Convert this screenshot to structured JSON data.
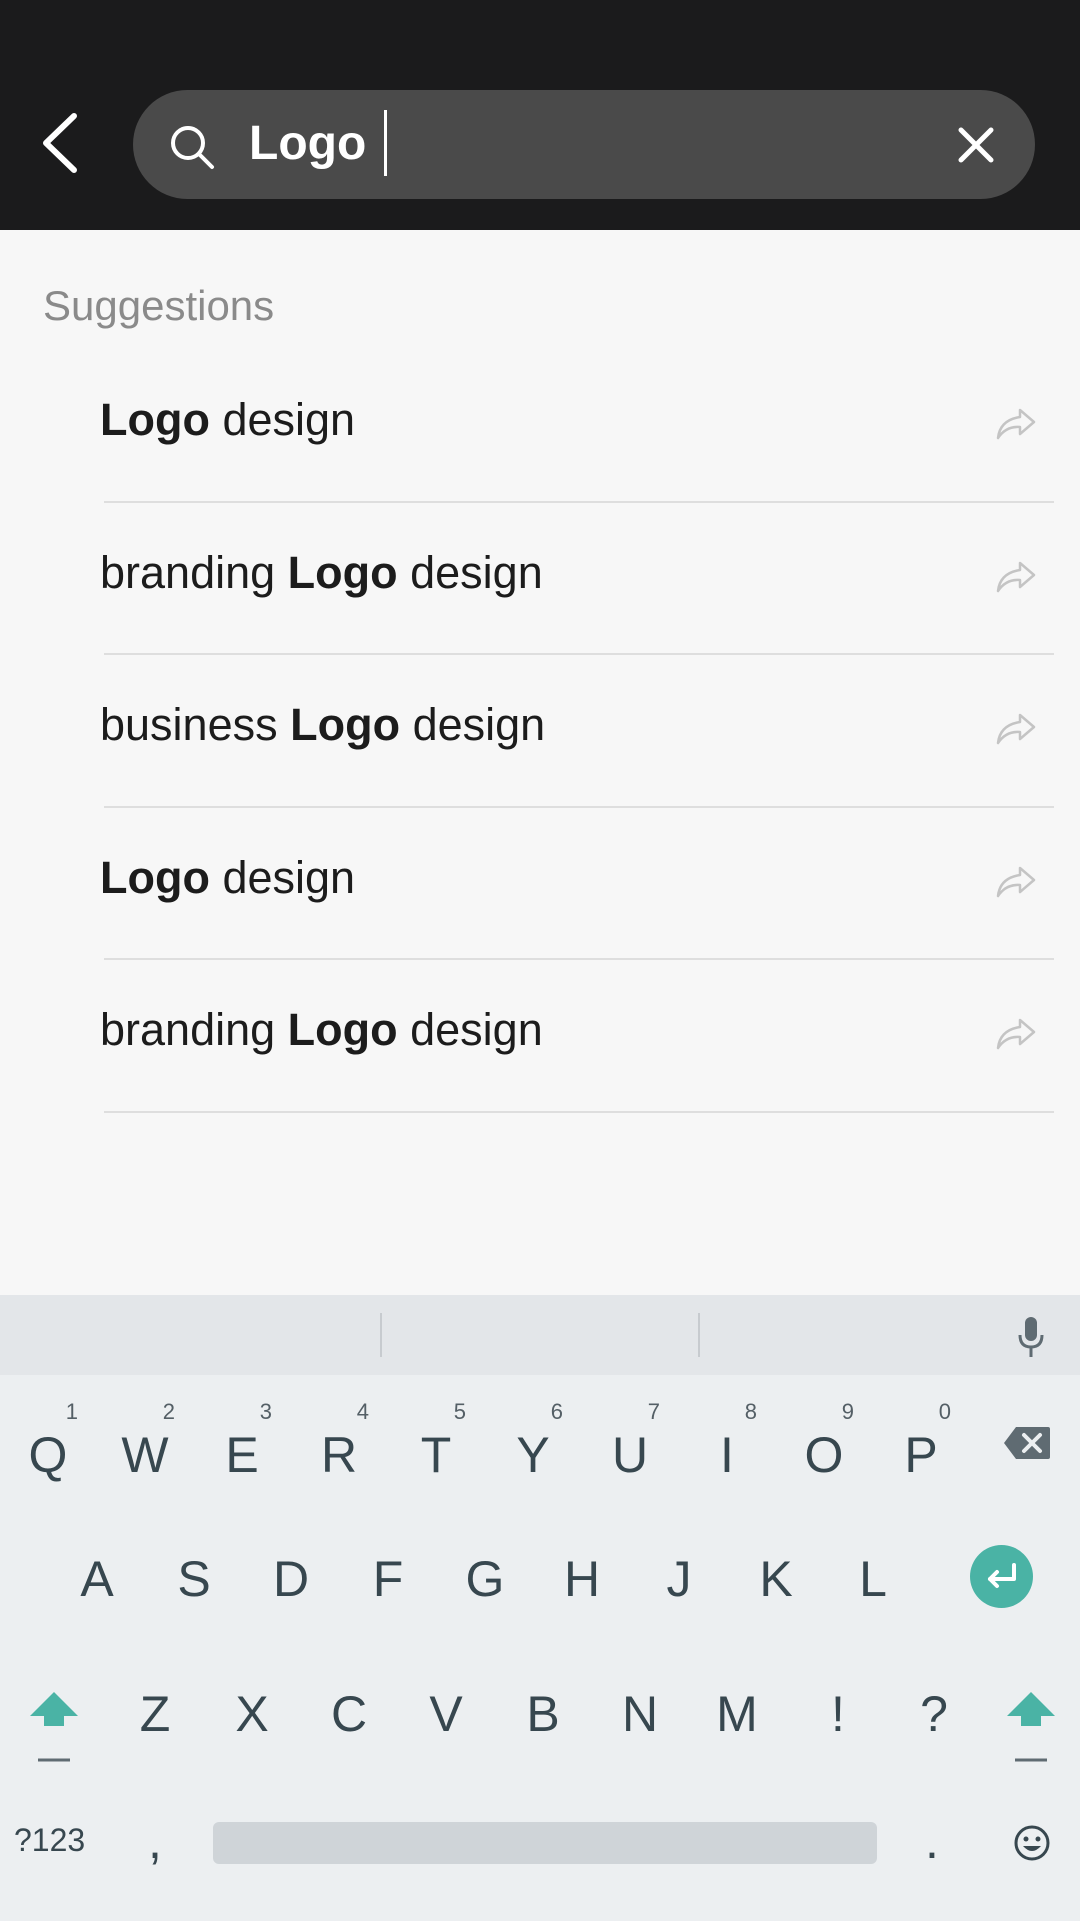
{
  "search": {
    "query": "Logo"
  },
  "suggestions": {
    "title": "Suggestions",
    "items": [
      {
        "pre": "",
        "bold": "Logo",
        "post": " design"
      },
      {
        "pre": "branding ",
        "bold": "Logo",
        "post": " design"
      },
      {
        "pre": "business ",
        "bold": "Logo",
        "post": " design"
      },
      {
        "pre": "",
        "bold": "Logo",
        "post": " design"
      },
      {
        "pre": "branding ",
        "bold": "Logo",
        "post": " design"
      }
    ]
  },
  "keyboard": {
    "row1": [
      {
        "k": "Q",
        "h": "1"
      },
      {
        "k": "W",
        "h": "2"
      },
      {
        "k": "E",
        "h": "3"
      },
      {
        "k": "R",
        "h": "4"
      },
      {
        "k": "T",
        "h": "5"
      },
      {
        "k": "Y",
        "h": "6"
      },
      {
        "k": "U",
        "h": "7"
      },
      {
        "k": "I",
        "h": "8"
      },
      {
        "k": "O",
        "h": "9"
      },
      {
        "k": "P",
        "h": "0"
      }
    ],
    "row2": [
      "A",
      "S",
      "D",
      "F",
      "G",
      "H",
      "J",
      "K",
      "L"
    ],
    "row3": [
      "Z",
      "X",
      "C",
      "V",
      "B",
      "N",
      "M",
      "!",
      "?"
    ],
    "symbols_label": "?123",
    "comma": ",",
    "period": "."
  },
  "colors": {
    "header_bg": "#1b1b1c",
    "searchbar_bg": "#4a4a4a",
    "accent": "#4ab3a5",
    "keyboard_bg": "#eceff1"
  },
  "icons": [
    "back-arrow-icon",
    "search-icon",
    "close-icon",
    "share-arrow-icon",
    "mic-icon",
    "backspace-icon",
    "enter-icon",
    "shift-icon",
    "emoji-icon"
  ]
}
